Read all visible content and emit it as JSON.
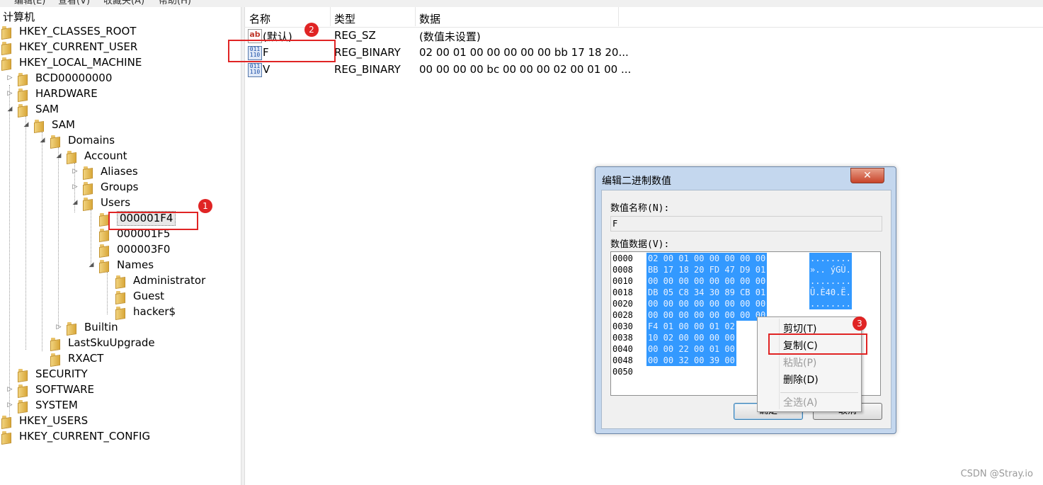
{
  "menubar": [
    "编辑(E)",
    "查看(V)",
    "收藏夹(A)",
    "帮助(H)"
  ],
  "tree": {
    "root": "计算机",
    "nodes": [
      {
        "label": "HKEY_CLASSES_ROOT"
      },
      {
        "label": "HKEY_CURRENT_USER"
      },
      {
        "label": "HKEY_LOCAL_MACHINE"
      },
      {
        "label": "BCD00000000"
      },
      {
        "label": "HARDWARE"
      },
      {
        "label": "SAM"
      },
      {
        "label": "SAM"
      },
      {
        "label": "Domains"
      },
      {
        "label": "Account"
      },
      {
        "label": "Aliases"
      },
      {
        "label": "Groups"
      },
      {
        "label": "Users"
      },
      {
        "label": "000001F4"
      },
      {
        "label": "000001F5"
      },
      {
        "label": "000003F0"
      },
      {
        "label": "Names"
      },
      {
        "label": "Administrator"
      },
      {
        "label": "Guest"
      },
      {
        "label": "hacker$"
      },
      {
        "label": "Builtin"
      },
      {
        "label": "LastSkuUpgrade"
      },
      {
        "label": "RXACT"
      },
      {
        "label": "SECURITY"
      },
      {
        "label": "SOFTWARE"
      },
      {
        "label": "SYSTEM"
      },
      {
        "label": "HKEY_USERS"
      },
      {
        "label": "HKEY_CURRENT_CONFIG"
      }
    ]
  },
  "list": {
    "headers": {
      "name": "名称",
      "type": "类型",
      "data": "数据"
    },
    "rows": [
      {
        "icon": "string-value-icon",
        "name": "(默认)",
        "type": "REG_SZ",
        "data": "(数值未设置)"
      },
      {
        "icon": "binary-value-icon",
        "name": "F",
        "type": "REG_BINARY",
        "data": "02 00 01 00 00 00 00 00 bb 17 18 20..."
      },
      {
        "icon": "binary-value-icon",
        "name": "V",
        "type": "REG_BINARY",
        "data": "00 00 00 00 bc 00 00 00 02 00 01 00 ..."
      }
    ]
  },
  "badges": {
    "one": "1",
    "two": "2",
    "three": "3"
  },
  "dialog": {
    "title": "编辑二进制数值",
    "close": "✕",
    "name_label": "数值名称(N):",
    "name_value": "F",
    "data_label": "数值数据(V):",
    "hex_lines": [
      {
        "addr": "0000",
        "bytes": "02 00 01 00 00 00 00 00",
        "ascii": "........"
      },
      {
        "addr": "0008",
        "bytes": "BB 17 18 20 FD 47 D9 01",
        "ascii": "».. ýGÙ."
      },
      {
        "addr": "0010",
        "bytes": "00 00 00 00 00 00 00 00",
        "ascii": "........"
      },
      {
        "addr": "0018",
        "bytes": "DB 05 C8 34 30 89 CB 01",
        "ascii": "Û.È40.Ë."
      },
      {
        "addr": "0020",
        "bytes": "00 00 00 00 00 00 00 00",
        "ascii": "........"
      },
      {
        "addr": "0028",
        "bytes": "00 00 00 00 00 00 00 00",
        "ascii": ""
      },
      {
        "addr": "0030",
        "bytes": "F4 01 00 00 01 02",
        "ascii": ""
      },
      {
        "addr": "0038",
        "bytes": "10 02 00 00 00 00",
        "ascii": ""
      },
      {
        "addr": "0040",
        "bytes": "00 00 22 00 01 00",
        "ascii": ""
      },
      {
        "addr": "0048",
        "bytes": "00 00 32 00 39 00",
        "ascii": ""
      },
      {
        "addr": "0050",
        "bytes": "",
        "ascii": ""
      }
    ],
    "ok": "确定",
    "cancel": "取消"
  },
  "context_menu": {
    "items": [
      {
        "label": "剪切(T)",
        "enabled": true
      },
      {
        "label": "复制(C)",
        "enabled": true
      },
      {
        "label": "粘贴(P)",
        "enabled": false
      },
      {
        "label": "删除(D)",
        "enabled": true
      },
      {
        "label": "全选(A)",
        "enabled": false
      }
    ]
  },
  "watermark": "CSDN @Stray.io",
  "colors": {
    "highlight": "#3399ff",
    "annotation_red": "#e02424",
    "dialog_frame": "#c4d7ee"
  }
}
